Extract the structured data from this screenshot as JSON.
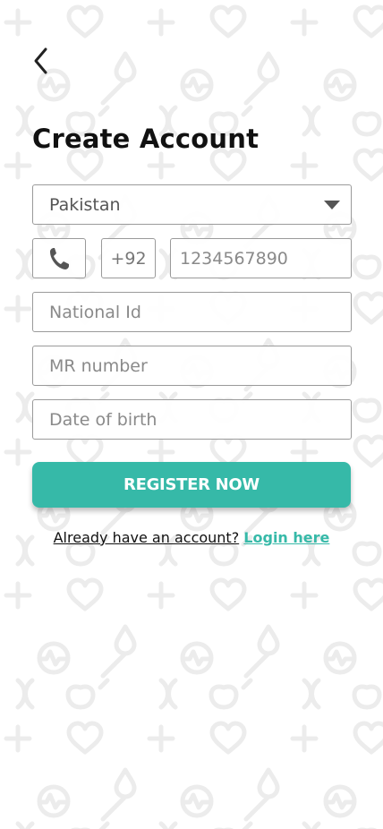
{
  "header": {
    "back_icon": "chevron-left-icon",
    "title": "Create Account"
  },
  "form": {
    "country": {
      "selected": "Pakistan",
      "icon": "caret-down-icon"
    },
    "phone": {
      "icon": "phone-icon",
      "country_code": "+92",
      "number_placeholder": "1234567890"
    },
    "national_id": {
      "placeholder": "National Id"
    },
    "mr_number": {
      "placeholder": "MR number"
    },
    "dob": {
      "placeholder": "Date of birth"
    },
    "register_label": "REGISTER NOW"
  },
  "footer": {
    "prompt": "Already have an account?",
    "link": "Login here"
  },
  "colors": {
    "accent": "#36b9a8",
    "pattern": "#ebebeb",
    "border": "#9a9a9a"
  }
}
